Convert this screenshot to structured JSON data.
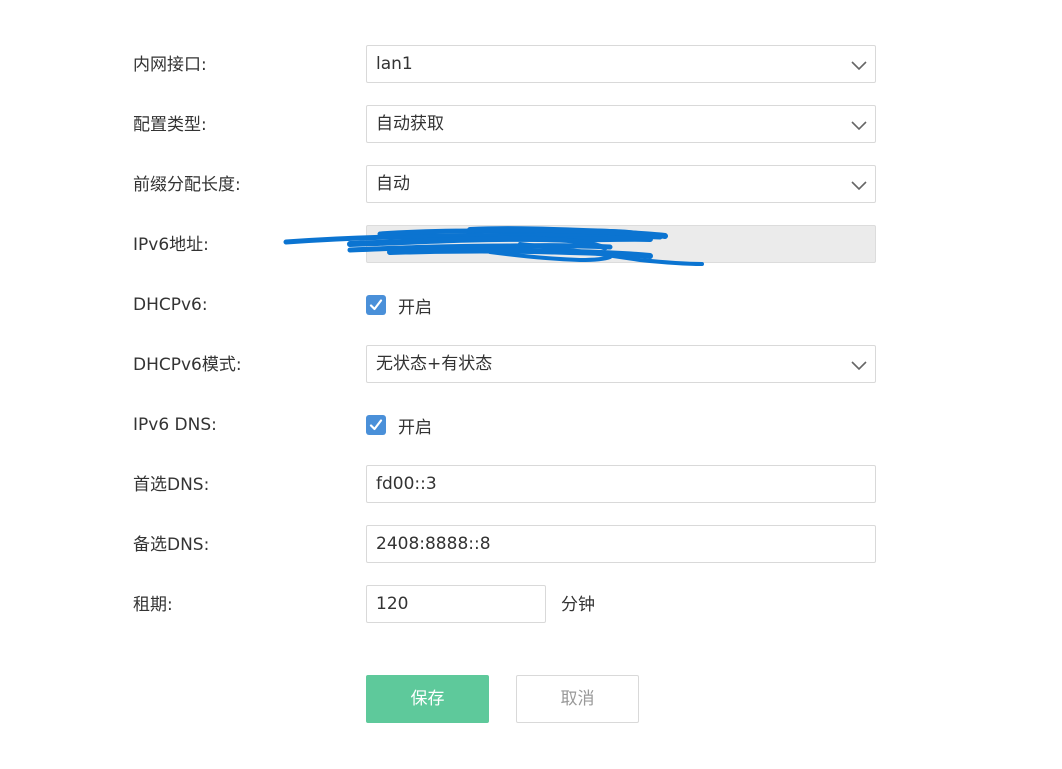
{
  "form": {
    "lan_interface": {
      "label": "内网接口:",
      "value": "lan1"
    },
    "config_type": {
      "label": "配置类型:",
      "value": "自动获取"
    },
    "prefix_length": {
      "label": "前缀分配长度:",
      "value": "自动"
    },
    "ipv6_address": {
      "label": "IPv6地址:",
      "value": ""
    },
    "dhcpv6": {
      "label": "DHCPv6:",
      "checkbox_label": "开启",
      "checked": true
    },
    "dhcpv6_mode": {
      "label": "DHCPv6模式:",
      "value": "无状态+有状态"
    },
    "ipv6_dns": {
      "label": "IPv6 DNS:",
      "checkbox_label": "开启",
      "checked": true
    },
    "primary_dns": {
      "label": "首选DNS:",
      "value": "fd00::3"
    },
    "secondary_dns": {
      "label": "备选DNS:",
      "value": "2408:8888::8"
    },
    "lease": {
      "label": "租期:",
      "value": "120",
      "unit": "分钟"
    }
  },
  "buttons": {
    "save": "保存",
    "cancel": "取消"
  },
  "icons": {
    "dropdown": "chevron-down-icon",
    "check": "checkmark-icon",
    "redaction": "redaction-scribble"
  },
  "colors": {
    "accent_green": "#5ec99b",
    "checkbox_blue": "#4a90d9",
    "redaction_blue": "#0b74d1",
    "readonly_bg": "#ebebeb"
  }
}
